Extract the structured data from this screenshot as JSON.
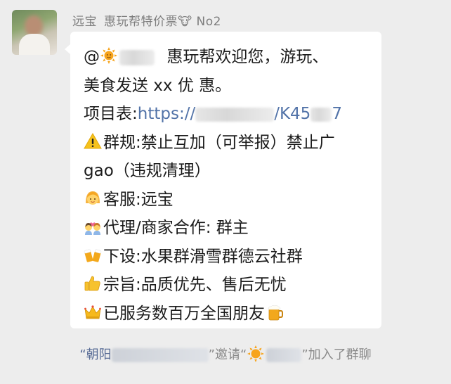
{
  "chat": {
    "sender_name": "远宝",
    "group_name": "惠玩帮特价票🐮 No2",
    "message": {
      "line1_prefix": "@",
      "line1_suffix": "惠玩帮欢迎您，游玩、",
      "line2": "美食发送 xx 优 惠。",
      "line3_label": "项目表:",
      "line3_link_start": "https://",
      "line3_link_mid": "/K45",
      "line3_link_end": "7",
      "line4": "群规:禁止互加（可举报）禁止广",
      "line5": "gao（违规清理）",
      "line6": "客服:远宝",
      "line7": "代理/商家合作: 群主",
      "line8": "下设:水果群滑雪群德云社群",
      "line9": "宗旨:品质优先、售后无忧",
      "line10": "已服务数百万全国朋友"
    },
    "system_notice": {
      "inviter": "“朝阳",
      "invite_text": "”邀请“",
      "joined_text": "”加入了群聊"
    }
  },
  "colors": {
    "bubble": "#ffffff",
    "background": "#ededed",
    "link": "#5273a8",
    "name_link": "#576b95"
  },
  "icons": [
    "sun-emoji",
    "warning-emoji",
    "girl-emoji",
    "couple-emoji",
    "beer-cheers-emoji",
    "thumbs-up-emoji",
    "crown-emoji",
    "beer-mug-emoji",
    "cow-emoji"
  ]
}
